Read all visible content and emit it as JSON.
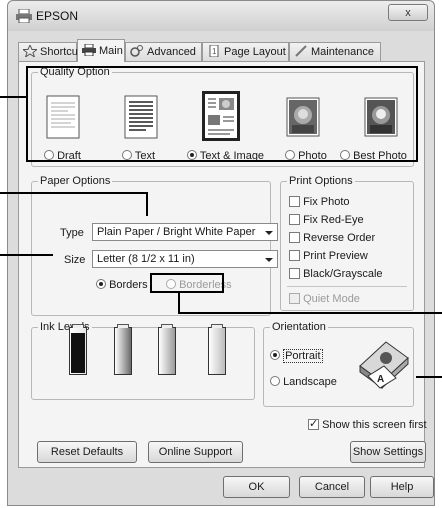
{
  "window": {
    "title": "EPSON",
    "close_label": "x"
  },
  "tabs": [
    {
      "label": "Shortcuts",
      "icon": "star-icon"
    },
    {
      "label": "Main",
      "icon": "printer-icon"
    },
    {
      "label": "Advanced",
      "icon": "gears-icon"
    },
    {
      "label": "Page Layout",
      "icon": "page-icon"
    },
    {
      "label": "Maintenance",
      "icon": "pen-icon"
    }
  ],
  "quality": {
    "title": "Quality Option",
    "options": [
      {
        "label": "Draft",
        "selected": false,
        "icon": "draft-page-icon"
      },
      {
        "label": "Text",
        "selected": false,
        "icon": "text-page-icon"
      },
      {
        "label": "Text & Image",
        "selected": true,
        "icon": "text-image-page-icon"
      },
      {
        "label": "Photo",
        "selected": false,
        "icon": "photo-icon"
      },
      {
        "label": "Best Photo",
        "selected": false,
        "icon": "best-photo-icon"
      }
    ]
  },
  "paper": {
    "title": "Paper Options",
    "type_label": "Type",
    "type_value": "Plain Paper / Bright White Paper",
    "size_label": "Size",
    "size_value": "Letter (8 1/2 x 11 in)",
    "borders_label": "Borders",
    "borderless_label": "Borderless",
    "borders_selected": true
  },
  "print_options": {
    "title": "Print Options",
    "items": [
      {
        "label": "Fix Photo",
        "checked": false
      },
      {
        "label": "Fix Red-Eye",
        "checked": false
      },
      {
        "label": "Reverse Order",
        "checked": false
      },
      {
        "label": "Print Preview",
        "checked": false
      },
      {
        "label": "Black/Grayscale",
        "checked": false
      }
    ],
    "quiet_mode_label": "Quiet Mode"
  },
  "ink": {
    "title": "Ink Levels",
    "cartridges": [
      {
        "color": "#111111",
        "level": 0.92
      },
      {
        "color": "#6a6a6a",
        "level": 0.0
      },
      {
        "color": "#9a9a9a",
        "level": 0.0
      },
      {
        "color": "#bcbcbc",
        "level": 0.0
      }
    ]
  },
  "orientation": {
    "title": "Orientation",
    "portrait_label": "Portrait",
    "landscape_label": "Landscape",
    "portrait_selected": true
  },
  "footer": {
    "show_screen_label": "Show this screen first",
    "show_screen_checked": true,
    "reset_label": "Reset Defaults",
    "support_label": "Online Support",
    "show_settings_label": "Show Settings",
    "ok_label": "OK",
    "cancel_label": "Cancel",
    "help_label": "Help"
  }
}
